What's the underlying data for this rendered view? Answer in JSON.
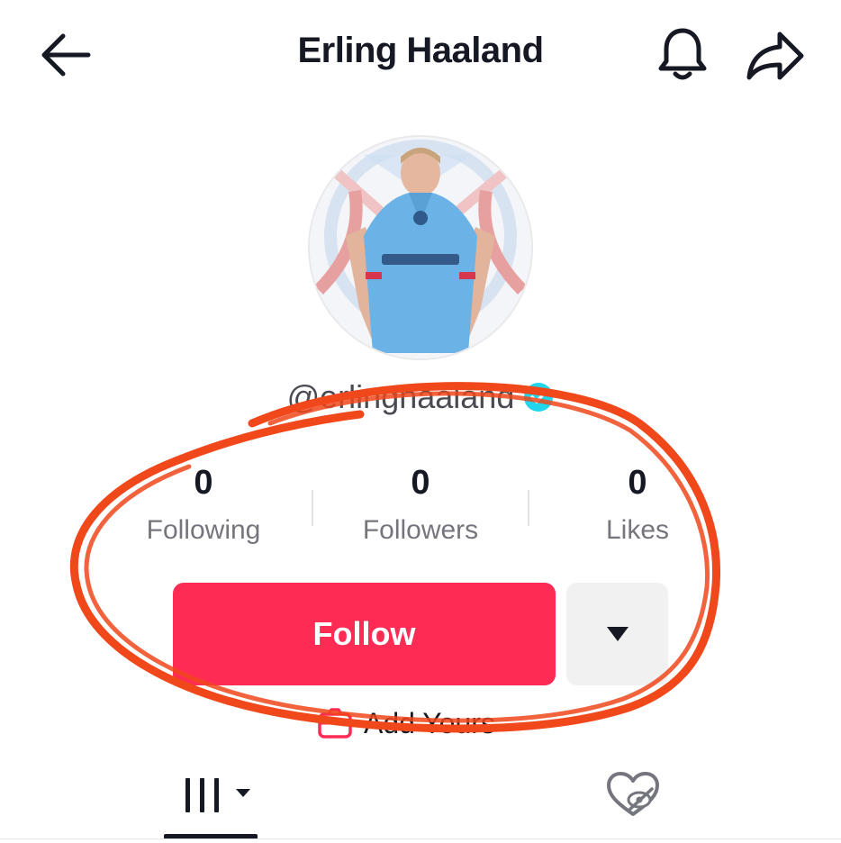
{
  "header": {
    "title": "Erling Haaland",
    "back_icon": "arrow-left-icon",
    "notification_icon": "bell-icon",
    "share_icon": "share-arrow-icon"
  },
  "profile": {
    "username": "@erlinghaaland",
    "verified": true,
    "avatar_icon": "profile-photo"
  },
  "stats": [
    {
      "value": "0",
      "label": "Following"
    },
    {
      "value": "0",
      "label": "Followers"
    },
    {
      "value": "0",
      "label": "Likes"
    }
  ],
  "actions": {
    "follow_label": "Follow",
    "more_icon": "caret-down-icon"
  },
  "add_yours": {
    "label": "Add Yours",
    "icon": "camera-icon"
  },
  "tabs": {
    "videos_icon": "grid-icon",
    "liked_icon": "hidden-heart-icon"
  },
  "colors": {
    "accent": "#fe2c55",
    "annotation": "#f0471b",
    "verified": "#20d5ec",
    "secondary_button": "#f1f1f2"
  }
}
